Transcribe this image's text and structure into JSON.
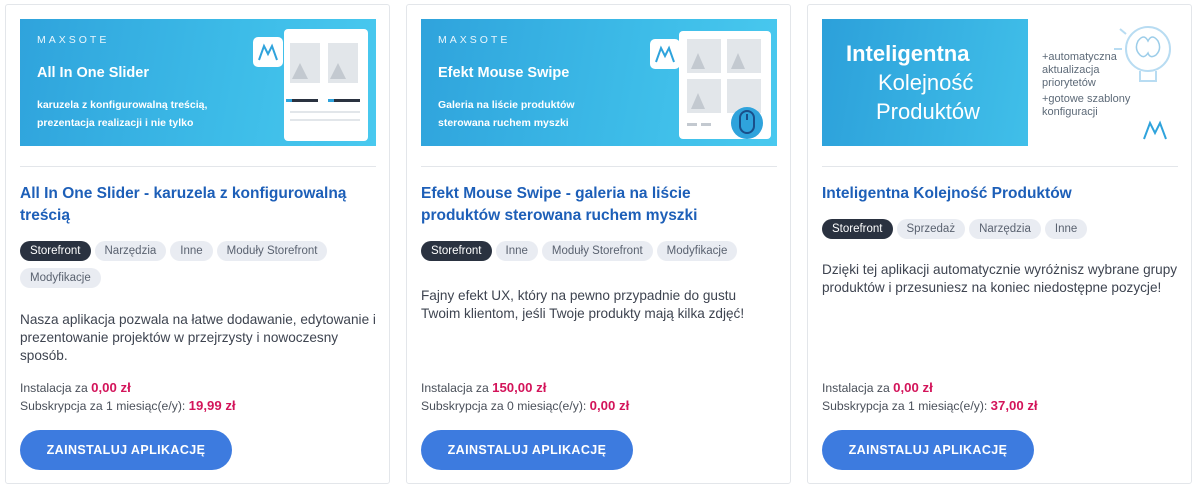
{
  "cards": [
    {
      "banner": {
        "brand": "MAXSOTE",
        "heading": "All In One Slider",
        "sub_line1": "karuzela z konfigurowalną treścią,",
        "sub_line2": "prezentacja realizacji i nie tylko"
      },
      "title": "All In One Slider - karuzela z konfigurowalną treścią",
      "tags": [
        "Storefront",
        "Narzędzia",
        "Inne",
        "Moduły Storefront",
        "Modyfikacje"
      ],
      "description": "Nasza aplikacja pozwala na łatwe dodawanie, edytowanie i prezentowanie projektów w przejrzysty i nowoczesny sposób.",
      "install_label": "Instalacja za",
      "install_price": "0,00 zł",
      "subscription_label": "Subskrypcja za 1 miesiąc(e/y):",
      "subscription_price": "19,99 zł",
      "button": "ZAINSTALUJ APLIKACJĘ"
    },
    {
      "banner": {
        "brand": "MAXSOTE",
        "heading": "Efekt Mouse Swipe",
        "sub_line1": "Galeria na liście produktów",
        "sub_line2": "sterowana ruchem myszki"
      },
      "title": "Efekt Mouse Swipe - galeria na liście produktów sterowana ruchem myszki",
      "tags": [
        "Storefront",
        "Inne",
        "Moduły Storefront",
        "Modyfikacje"
      ],
      "description": "Fajny efekt UX, który na pewno przypadnie do gustu Twoim klientom, jeśli Twoje produkty mają kilka zdjęć!",
      "install_label": "Instalacja za",
      "install_price": "150,00 zł",
      "subscription_label": "Subskrypcja za 0 miesiąc(e/y):",
      "subscription_price": "0,00 zł",
      "button": "ZAINSTALUJ APLIKACJĘ"
    },
    {
      "banner": {
        "line1": "Inteligentna",
        "line2": "Kolejność",
        "line3": "Produktów",
        "right1": "+automatyczna",
        "right2": "aktualizacja",
        "right3": "priorytetów",
        "right4": "+gotowe szablony",
        "right5": "konfiguracji"
      },
      "title": "Inteligentna Kolejność Produktów",
      "tags": [
        "Storefront",
        "Sprzedaż",
        "Narzędzia",
        "Inne"
      ],
      "description": "Dzięki tej aplikacji automatycznie wyróżnisz wybrane grupy produktów i przesuniesz na koniec niedostępne pozycje!",
      "install_label": "Instalacja za",
      "install_price": "0,00 zł",
      "subscription_label": "Subskrypcja za 1 miesiąc(e/y):",
      "subscription_price": "37,00 zł",
      "button": "ZAINSTALUJ APLIKACJĘ"
    }
  ],
  "colors": {
    "title": "#1d5fb8",
    "price": "#d3145a",
    "button": "#3d7bdf",
    "tag_active": "#2a3240",
    "tag": "#e9ecf2"
  }
}
